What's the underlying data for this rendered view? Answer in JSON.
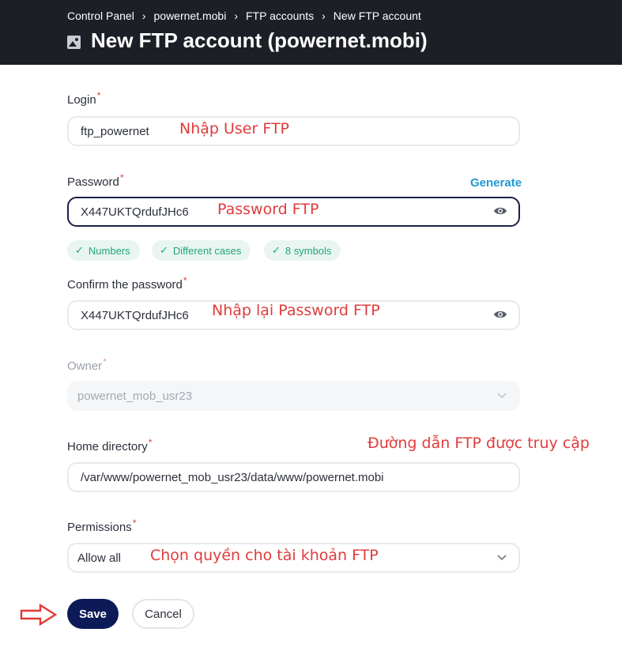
{
  "breadcrumb": {
    "items": [
      "Control Panel",
      "powernet.mobi",
      "FTP accounts",
      "New FTP account"
    ],
    "separator": "›"
  },
  "page": {
    "title": "New FTP account (powernet.mobi)",
    "title_icon": "image-icon"
  },
  "form": {
    "required_mark": "*",
    "login": {
      "label": "Login",
      "value": "ftp_powernet"
    },
    "password": {
      "label": "Password",
      "value": "X447UKTQrdufJHc6",
      "generate_label": "Generate",
      "hints": [
        "Numbers",
        "Different cases",
        "8 symbols"
      ]
    },
    "confirm_password": {
      "label": "Confirm the password",
      "value": "X447UKTQrdufJHc6"
    },
    "owner": {
      "label": "Owner",
      "value": "powernet_mob_usr23"
    },
    "home_directory": {
      "label": "Home directory",
      "value": "/var/www/powernet_mob_usr23/data/www/powernet.mobi"
    },
    "permissions": {
      "label": "Permissions",
      "value": "Allow all"
    }
  },
  "buttons": {
    "save": "Save",
    "cancel": "Cancel"
  },
  "annotations": {
    "login": "Nhập User FTP",
    "password": "Password FTP",
    "confirm": "Nhập lại Password FTP",
    "home_dir": "Đường dẫn FTP được truy cập",
    "permissions": "Chọn quyền cho tài khoản FTP"
  },
  "colors": {
    "header_bg": "#1d1f27",
    "accent_link": "#1e9ad6",
    "primary_button": "#0c1a57",
    "hint_green": "#21a67a",
    "annotation_red": "#e03b3b"
  }
}
